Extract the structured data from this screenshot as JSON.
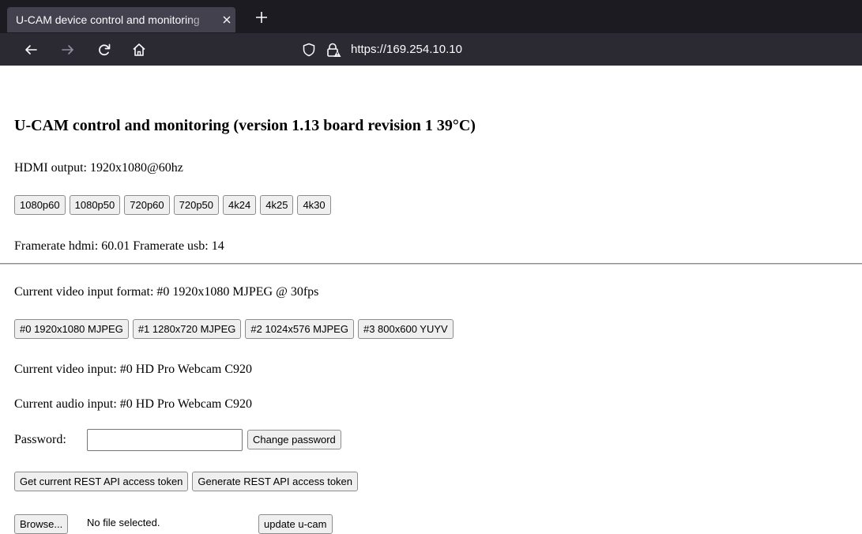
{
  "browser": {
    "tab_title": "U-CAM device control and monitoring",
    "url": "https://169.254.10.10",
    "colors": {
      "tabbar": "#1c1b22",
      "tab_active": "#42414d",
      "navbar": "#2b2a33",
      "text": "#fbfbfe"
    }
  },
  "page": {
    "title": "U-CAM control and monitoring (version 1.13 board revision 1 39°C)",
    "hdmi_output": "HDMI output: 1920x1080@60hz",
    "hdmi_buttons": [
      "1080p60",
      "1080p50",
      "720p60",
      "720p50",
      "4k24",
      "4k25",
      "4k30"
    ],
    "framerate": "Framerate hdmi: 60.01 Framerate usb: 14",
    "current_video_format": "Current video input format: #0 1920x1080 MJPEG @ 30fps",
    "format_buttons": [
      "#0 1920x1080 MJPEG",
      "#1 1280x720 MJPEG",
      "#2 1024x576 MJPEG",
      "#3 800x600 YUYV"
    ],
    "current_video_input": "Current video input: #0 HD Pro Webcam C920",
    "current_audio_input": "Current audio input: #0 HD Pro Webcam C920",
    "password_label": "Password:",
    "password_value": "",
    "change_password_label": "Change password",
    "get_token_label": "Get current REST API access token",
    "generate_token_label": "Generate REST API access token",
    "browse_label": "Browse...",
    "no_file_label": "No file selected.",
    "update_label": "update u-cam"
  }
}
